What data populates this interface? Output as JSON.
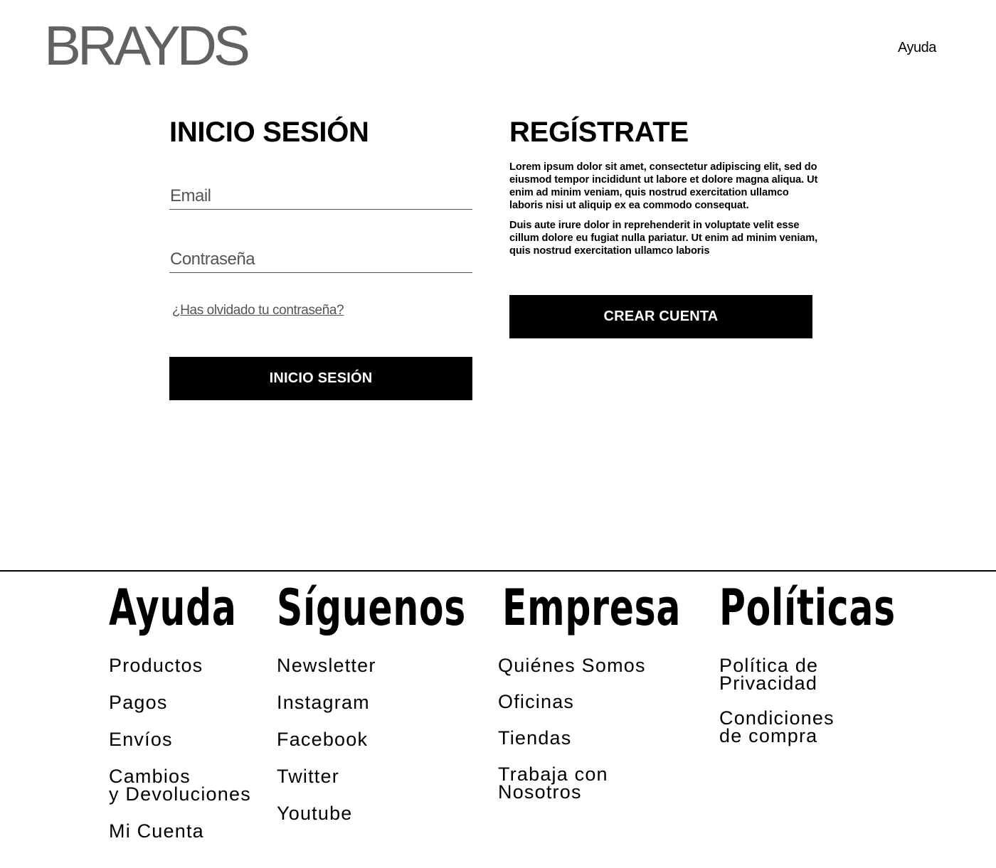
{
  "header": {
    "logo": "BRAYDS",
    "help_label": "Ayuda"
  },
  "login": {
    "title": "INICIO SESIÓN",
    "email_placeholder": "Email",
    "password_placeholder": "Contraseña",
    "forgot_label": "¿Has olvidado tu contraseña?",
    "submit_label": "INICIO SESIÓN"
  },
  "register": {
    "title": "REGÍSTRATE",
    "paragraph1": "Lorem ipsum dolor sit amet,  consectetur adipiscing elit, sed do eiusmod tempor incididunt ut labore et dolore magna aliqua. Ut enim ad minim veniam, quis nostrud exercitation ullamco laboris nisi ut aliquip ex ea commodo consequat.",
    "paragraph2": "Duis aute irure dolor in reprehenderit in voluptate velit esse cillum dolore eu fugiat nulla pariatur. Ut enim ad minim veniam, quis nostrud exercitation ullamco laboris",
    "submit_label": "CREAR CUENTA"
  },
  "footer": {
    "columns": [
      {
        "title": "Ayuda",
        "items": [
          "Productos",
          "Pagos",
          "Envíos",
          "Cambios\ny Devoluciones",
          "Mi Cuenta"
        ]
      },
      {
        "title": "Síguenos",
        "items": [
          "Newsletter",
          "Instagram",
          "Facebook",
          "Twitter",
          "Youtube"
        ]
      },
      {
        "title": "Empresa",
        "items": [
          "Quiénes Somos",
          "Oficinas",
          "Tiendas",
          "Trabaja con\nNosotros"
        ]
      },
      {
        "title": "Políticas",
        "items": [
          "Política de\nPrivacidad",
          "Condiciones\nde compra"
        ]
      }
    ]
  },
  "colors": {
    "logo": "#616161",
    "button_bg": "#000000",
    "button_text": "#ffffff"
  }
}
